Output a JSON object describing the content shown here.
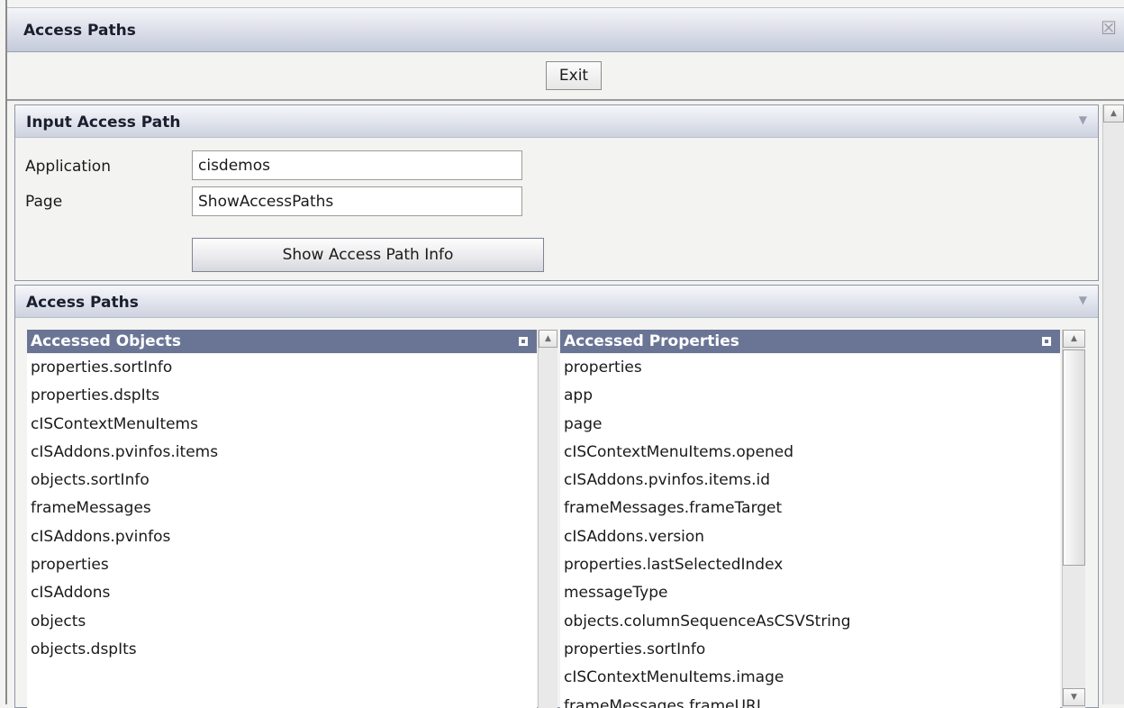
{
  "window": {
    "title": "Access Paths",
    "close_icon": "close-icon"
  },
  "toolbar": {
    "exit_label": "Exit"
  },
  "input_panel": {
    "title": "Input Access Path",
    "application_label": "Application",
    "application_value": "cisdemos",
    "page_label": "Page",
    "page_value": "ShowAccessPaths",
    "show_button_label": "Show Access Path Info"
  },
  "paths_panel": {
    "title": "Access Paths",
    "objects": {
      "header": "Accessed Objects",
      "items": [
        "properties.sortInfo",
        "properties.dspIts",
        "cISContextMenuItems",
        "cISAddons.pvinfos.items",
        "objects.sortInfo",
        "frameMessages",
        "cISAddons.pvinfos",
        "properties",
        "cISAddons",
        "objects",
        "objects.dspIts"
      ]
    },
    "properties": {
      "header": "Accessed Properties",
      "items": [
        "properties",
        "app",
        "page",
        "cISContextMenuItems.opened",
        "cISAddons.pvinfos.items.id",
        "frameMessages.frameTarget",
        "cISAddons.version",
        "properties.lastSelectedIndex",
        "messageType",
        "objects.columnSequenceAsCSVString",
        "properties.sortInfo",
        "cISContextMenuItems.image",
        "frameMessages.frameURL"
      ]
    }
  }
}
